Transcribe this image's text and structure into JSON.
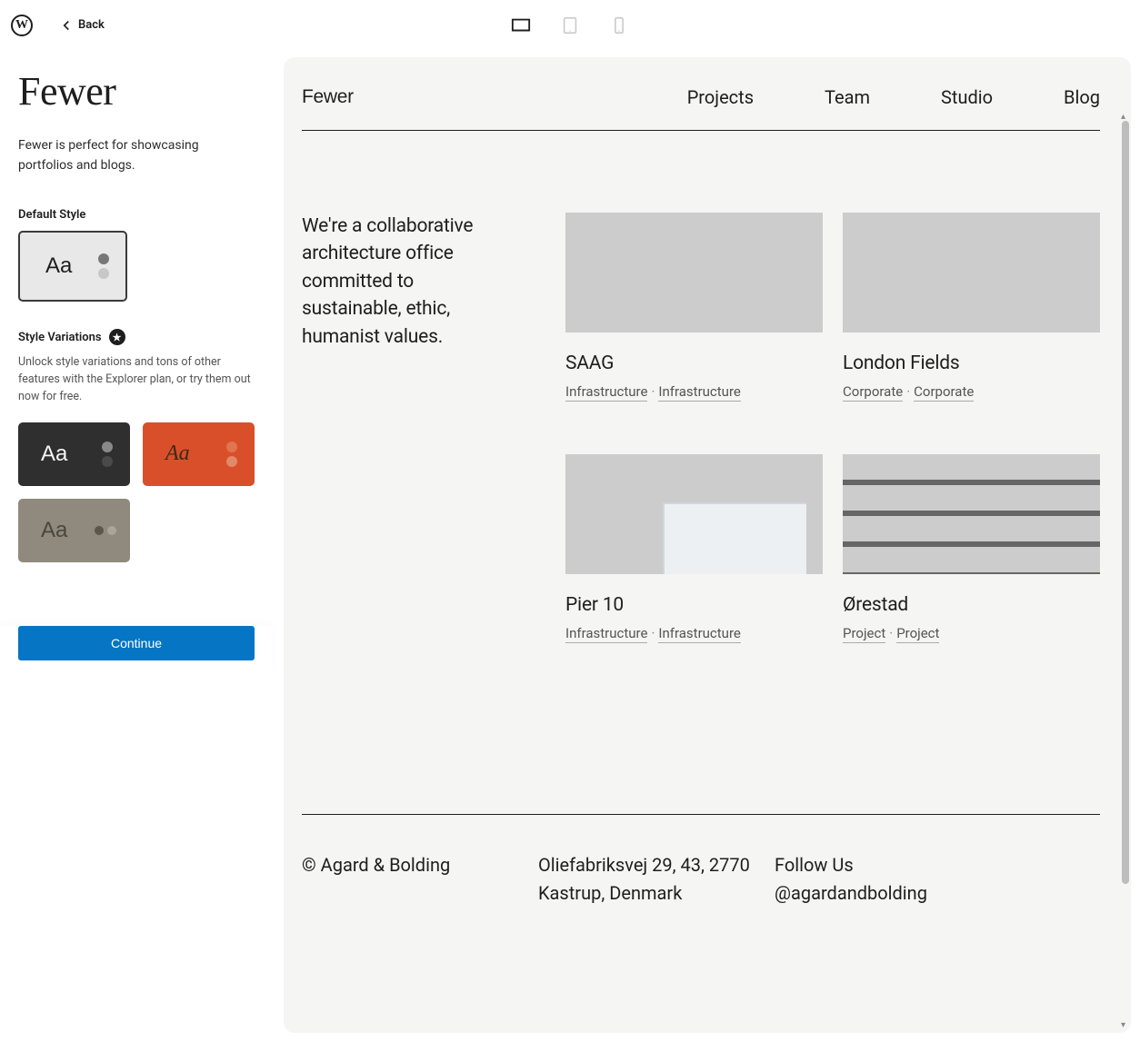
{
  "topbar": {
    "back_label": "Back"
  },
  "sidebar": {
    "theme_name": "Fewer",
    "theme_desc": "Fewer is perfect for showcasing portfolios and blogs.",
    "default_style_label": "Default Style",
    "style_variations_label": "Style Variations",
    "variation_desc": "Unlock style variations and tons of other features with the Explorer plan, or try them out now for free.",
    "aa_sample": "Aa",
    "continue_label": "Continue"
  },
  "preview": {
    "site_title": "Fewer",
    "nav": [
      "Projects",
      "Team",
      "Studio",
      "Blog"
    ],
    "intro": "We're a collaborative architecture office committed to sustainable, ethic, humanist values.",
    "projects": [
      {
        "title": "SAAG",
        "tag1": "Infrastructure",
        "tag2": "Infrastructure"
      },
      {
        "title": "London Fields",
        "tag1": "Corporate",
        "tag2": "Corporate"
      },
      {
        "title": "Pier 10",
        "tag1": "Infrastructure",
        "tag2": "Infrastructure"
      },
      {
        "title": "Ørestad",
        "tag1": "Project",
        "tag2": "Project"
      }
    ],
    "footer": {
      "copyright": "© Agard & Bolding",
      "address_line1": "Oliefabriksvej 29, 43, 2770",
      "address_line2": "Kastrup, Denmark",
      "follow_label": "Follow Us",
      "handle": "@agardandbolding"
    }
  }
}
